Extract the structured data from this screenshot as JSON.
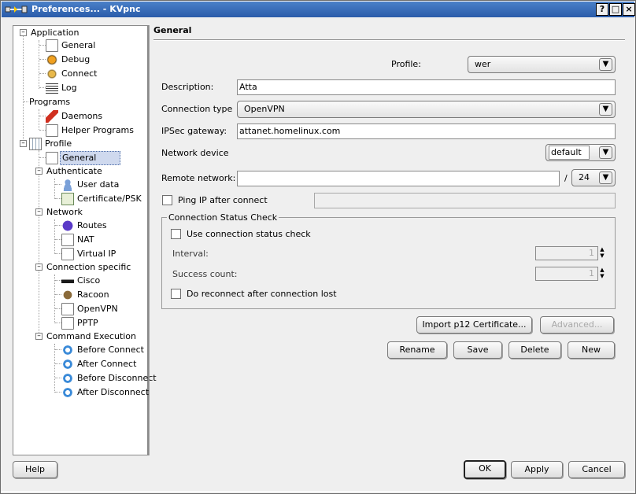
{
  "window": {
    "title": "Preferences... - KVpnc",
    "controls": [
      "?",
      "□",
      "×"
    ]
  },
  "tree": {
    "application": "Application",
    "app_general": "General",
    "app_debug": "Debug",
    "app_connect": "Connect",
    "app_log": "Log",
    "programs": "Programs",
    "daemons": "Daemons",
    "helper_programs": "Helper Programs",
    "profile": "Profile",
    "profile_general": "General",
    "authenticate": "Authenticate",
    "user_data": "User data",
    "certificate_psk": "Certificate/PSK",
    "network": "Network",
    "routes": "Routes",
    "nat": "NAT",
    "virtual_ip": "Virtual IP",
    "connection_specific": "Connection specific",
    "cisco": "Cisco",
    "racoon": "Racoon",
    "openvpn": "OpenVPN",
    "pptp": "PPTP",
    "command_execution": "Command Execution",
    "before_connect": "Before Connect",
    "after_connect": "After Connect",
    "before_disconnect": "Before Disconnect",
    "after_disconnect": "After Disconnect"
  },
  "panel": {
    "heading": "General",
    "profile_label": "Profile:",
    "profile_value": "wer",
    "description_label": "Description:",
    "description_value": "Atta",
    "connection_type_label": "Connection type",
    "connection_type_value": "OpenVPN",
    "ipsec_gateway_label": "IPSec gateway:",
    "ipsec_gateway_value": "attanet.homelinux.com",
    "network_device_label": "Network device",
    "network_device_value": "default",
    "remote_network_label": "Remote network:",
    "remote_network_value": "",
    "netmask_separator": "/",
    "netmask_value": "24",
    "ping_ip_label": "Ping IP after connect",
    "ping_ip_value": "",
    "status_group_title": "Connection Status Check",
    "use_status_check_label": "Use connection status check",
    "interval_label": "Interval:",
    "interval_value": "1",
    "success_count_label": "Success count:",
    "success_count_value": "1",
    "reconnect_label": "Do reconnect after connection lost",
    "import_p12_button": "Import p12 Certificate...",
    "advanced_button": "Advanced...",
    "rename_button": "Rename",
    "save_button": "Save",
    "delete_button": "Delete",
    "new_button": "New"
  },
  "footer": {
    "help_button": "Help",
    "ok_button": "OK",
    "apply_button": "Apply",
    "cancel_button": "Cancel"
  },
  "colors": {
    "titlebar": "#2a5caa",
    "selection": "#cfd9ee",
    "background": "#efefef"
  }
}
